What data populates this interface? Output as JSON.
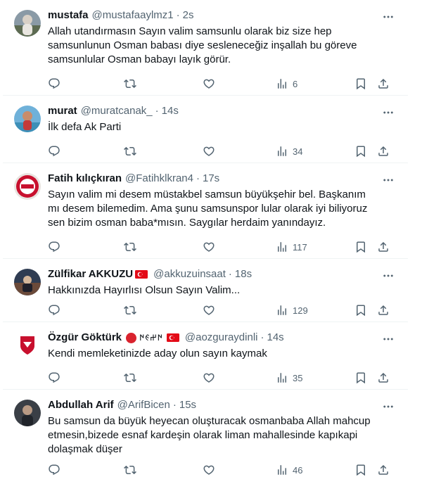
{
  "tweets": [
    {
      "name": "mustafa",
      "handle": "@mustafaaylmz1",
      "time": "2s",
      "text": "Allah utandırmasın Sayın valim samsunlu olarak biz size hep samsunlunun Osman babası diye sesleneceğiz inşallah bu göreve samsunlular Osman babayı layık görür.",
      "views": "6"
    },
    {
      "name": "murat",
      "handle": "@muratcanak_",
      "time": "14s",
      "text": "İlk defa Ak Parti",
      "views": "34"
    },
    {
      "name": "Fatih kılıçkıran",
      "handle": "@Fatihklkran4",
      "time": "17s",
      "text": "Sayın valim mi desem müstakbel samsun büyükşehir bel. Başkanım mı desem bilemedim. Ama şunu samsunspor lular olarak iyi biliyoruz sen bizim osman baba*mısın. Saygılar herdaim yanındayız.",
      "views": "117"
    },
    {
      "name": "Zülfikar AKKUZU",
      "handle": "@akkuzuinsaat",
      "time": "18s",
      "text": "Hakkınızda Hayırlısı Olsun Sayın Valim...",
      "views": "129"
    },
    {
      "name": "Özgür Göktürk",
      "name_glyphs": "𐰇𐰔𐰏𐰇",
      "handle": "@aozguraydinli",
      "time": "14s",
      "text": "Kendi memleketinizde aday olun sayın kaymak",
      "views": "35"
    },
    {
      "name": "Abdullah Arif",
      "handle": "@ArifBicen",
      "time": "15s",
      "text": "Bu samsun da büyük heyecan oluşturacak osmanbaba Allah mahcup etmesin,bizede esnaf kardeşin olarak liman mahallesinde kapıkapi dolaşmak düşer",
      "views": "46"
    }
  ],
  "colors": {
    "text": "#0f1419",
    "secondary": "#536471",
    "divider": "#eff3f4",
    "flag_red": "#e30a17"
  },
  "icons": [
    "reply-icon",
    "retweet-icon",
    "like-icon",
    "views-icon",
    "bookmark-icon",
    "share-icon",
    "more-icon"
  ]
}
